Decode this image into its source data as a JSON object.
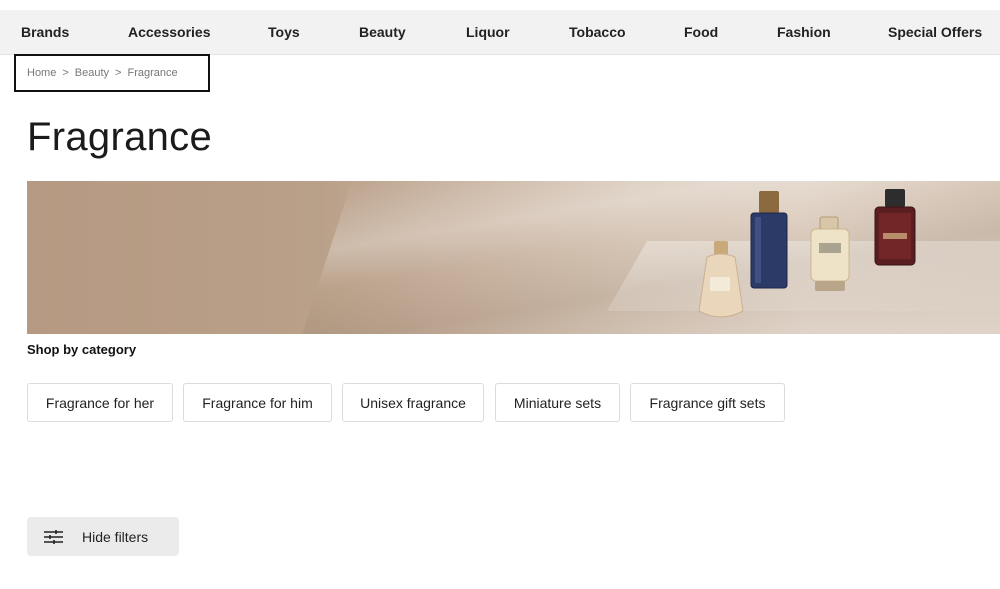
{
  "nav": {
    "items": [
      {
        "label": "Brands"
      },
      {
        "label": "Accessories"
      },
      {
        "label": "Toys"
      },
      {
        "label": "Beauty"
      },
      {
        "label": "Liquor"
      },
      {
        "label": "Tobacco"
      },
      {
        "label": "Food"
      },
      {
        "label": "Fashion"
      },
      {
        "label": "Special Offers"
      }
    ]
  },
  "breadcrumb": {
    "items": [
      "Home",
      "Beauty",
      "Fragrance"
    ],
    "separator": ">"
  },
  "page": {
    "title": "Fragrance"
  },
  "banner": {
    "colors": {
      "base": "#b69982",
      "highlight": "#e0d2c5"
    }
  },
  "categories": {
    "heading": "Shop by category",
    "chips": [
      {
        "label": "Fragrance for her"
      },
      {
        "label": "Fragrance for him"
      },
      {
        "label": "Unisex fragrance"
      },
      {
        "label": "Miniature sets"
      },
      {
        "label": "Fragrance gift sets"
      }
    ]
  },
  "filters": {
    "toggle_label": "Hide filters",
    "icon": "sliders-icon"
  }
}
